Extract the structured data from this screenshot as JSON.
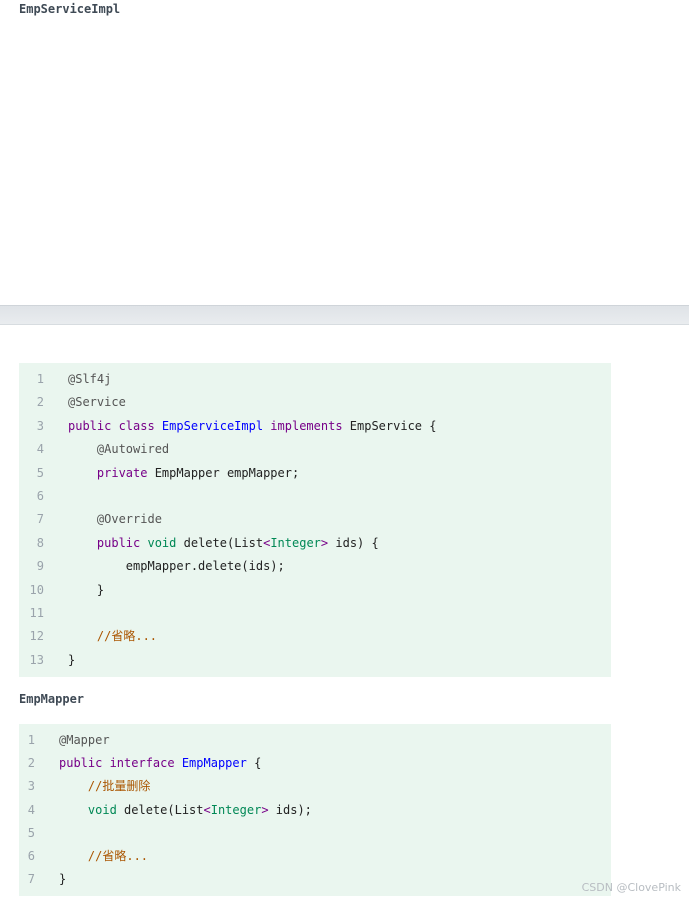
{
  "headings": {
    "first": "EmpServiceImpl",
    "second": "EmpMapper"
  },
  "code_block_1": {
    "lines": [
      {
        "n": "1",
        "tokens": [
          {
            "t": "@Slf4j",
            "k": "anno"
          }
        ]
      },
      {
        "n": "2",
        "tokens": [
          {
            "t": "@Service",
            "k": "anno"
          }
        ]
      },
      {
        "n": "3",
        "tokens": [
          {
            "t": "public class ",
            "k": "kw"
          },
          {
            "t": "EmpServiceImpl",
            "k": "cls"
          },
          {
            "t": " implements ",
            "k": "kw"
          },
          {
            "t": "EmpService {",
            "k": "plain"
          }
        ]
      },
      {
        "n": "4",
        "tokens": [
          {
            "t": "    @Autowired",
            "k": "anno"
          }
        ]
      },
      {
        "n": "5",
        "tokens": [
          {
            "t": "    private ",
            "k": "kw"
          },
          {
            "t": "EmpMapper empMapper;",
            "k": "plain"
          }
        ]
      },
      {
        "n": "6",
        "tokens": []
      },
      {
        "n": "7",
        "tokens": [
          {
            "t": "    @Override",
            "k": "anno"
          }
        ]
      },
      {
        "n": "8",
        "tokens": [
          {
            "t": "    public ",
            "k": "kw"
          },
          {
            "t": "void",
            "k": "type"
          },
          {
            "t": " delete(List",
            "k": "plain"
          },
          {
            "t": "<",
            "k": "kw"
          },
          {
            "t": "Integer",
            "k": "type"
          },
          {
            "t": ">",
            "k": "kw"
          },
          {
            "t": " ids) {",
            "k": "plain"
          }
        ]
      },
      {
        "n": "9",
        "tokens": [
          {
            "t": "        empMapper.delete(ids);",
            "k": "plain"
          }
        ]
      },
      {
        "n": "10",
        "tokens": [
          {
            "t": "    }",
            "k": "plain"
          }
        ]
      },
      {
        "n": "11",
        "tokens": []
      },
      {
        "n": "12",
        "tokens": [
          {
            "t": "    //省略...",
            "k": "comment"
          }
        ]
      },
      {
        "n": "13",
        "tokens": [
          {
            "t": "}",
            "k": "plain"
          }
        ]
      }
    ]
  },
  "code_block_2": {
    "lines": [
      {
        "n": "1",
        "tokens": [
          {
            "t": "@Mapper",
            "k": "anno"
          }
        ]
      },
      {
        "n": "2",
        "tokens": [
          {
            "t": "public interface ",
            "k": "kw"
          },
          {
            "t": "EmpMapper",
            "k": "cls"
          },
          {
            "t": " {",
            "k": "plain"
          }
        ]
      },
      {
        "n": "3",
        "tokens": [
          {
            "t": "    //批量删除",
            "k": "comment"
          }
        ]
      },
      {
        "n": "4",
        "tokens": [
          {
            "t": "    void",
            "k": "type"
          },
          {
            "t": " delete(List",
            "k": "plain"
          },
          {
            "t": "<",
            "k": "kw"
          },
          {
            "t": "Integer",
            "k": "type"
          },
          {
            "t": ">",
            "k": "kw"
          },
          {
            "t": " ids);",
            "k": "plain"
          }
        ]
      },
      {
        "n": "5",
        "tokens": []
      },
      {
        "n": "6",
        "tokens": [
          {
            "t": "    //省略...",
            "k": "comment"
          }
        ]
      },
      {
        "n": "7",
        "tokens": [
          {
            "t": "}",
            "k": "plain"
          }
        ]
      }
    ]
  },
  "watermark": "CSDN @ClovePink"
}
